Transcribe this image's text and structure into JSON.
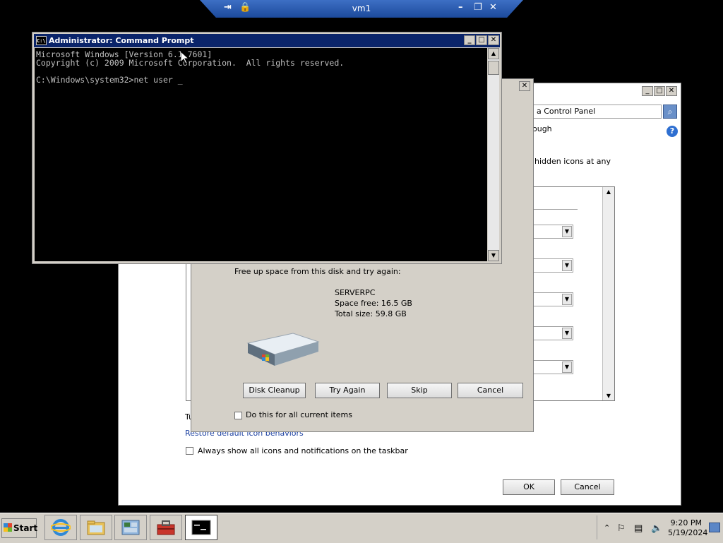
{
  "rdp": {
    "title": "vm1"
  },
  "cmd": {
    "title": "Administrator: Command Prompt",
    "icon_text": "C:\\",
    "lines": [
      "Microsoft Windows [Version 6.1.7601]",
      "Copyright (c) 2009 Microsoft Corporation.  All rights reserved.",
      "",
      "C:\\Windows\\system32>net user _"
    ]
  },
  "control_panel": {
    "search_text": "a Control Panel",
    "fragment_1": "ough",
    "fragment_2": "hidden icons at any",
    "fragment_3": "Tu",
    "restore_link": "Restore default icon behaviors",
    "always_show_label": "Always show all icons and notifications on the taskbar",
    "ok_label": "OK",
    "cancel_label": "Cancel"
  },
  "disk_dialog": {
    "message": "Free up space from this disk and try again:",
    "drive_name": "SERVERPC",
    "space_free": "Space free: 16.5 GB",
    "total_size": "Total size: 59.8 GB",
    "btn_disk_cleanup": "Disk Cleanup",
    "btn_try_again": "Try Again",
    "btn_skip": "Skip",
    "btn_cancel": "Cancel",
    "checkbox_label": "Do this for all current items"
  },
  "taskbar": {
    "start_label": "Start",
    "time": "9:20 PM",
    "date": "5/19/2024"
  }
}
